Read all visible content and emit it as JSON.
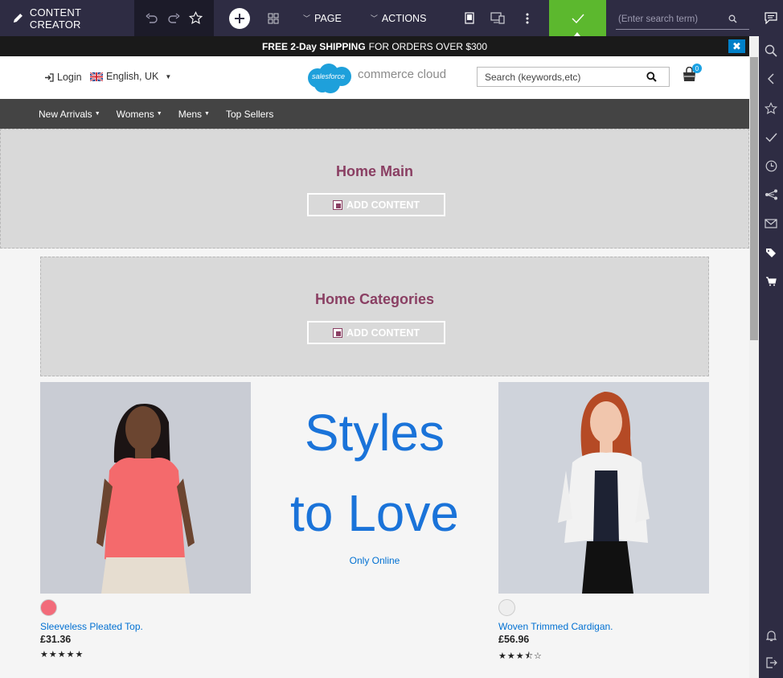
{
  "toolbar": {
    "brand": "CONTENT CREATOR",
    "page_menu": "PAGE",
    "actions_menu": "ACTIONS",
    "search_placeholder": "(Enter search term)",
    "add_icon": "plus-icon"
  },
  "site": {
    "promo_bold": "FREE 2-Day SHIPPING",
    "promo_rest": "FOR ORDERS OVER $300",
    "close_label": "✖",
    "login": "Login",
    "language": "English, UK",
    "logo_cloud": "salesforce",
    "logo_text": "commerce cloud",
    "search_placeholder": "Search (keywords,etc)",
    "cart_count": "0",
    "nav": [
      {
        "label": "New Arrivals",
        "dropdown": true
      },
      {
        "label": "Womens",
        "dropdown": true
      },
      {
        "label": "Mens",
        "dropdown": true
      },
      {
        "label": "Top Sellers",
        "dropdown": false
      }
    ]
  },
  "regions": {
    "home_main": {
      "title": "Home Main",
      "button": "ADD CONTENT"
    },
    "home_categories": {
      "title": "Home Categories",
      "button": "ADD CONTENT"
    }
  },
  "promo_block": {
    "line1": "Styles",
    "line2": "to Love",
    "link": "Only Online"
  },
  "products": [
    {
      "name": "Sleeveless Pleated Top.",
      "price": "£31.36",
      "rating": 5,
      "swatch_color": "#f26b7a"
    },
    {
      "name": "Woven Trimmed Cardigan.",
      "price": "£56.96",
      "rating": 3.5,
      "swatch_color": "#eeeeee"
    }
  ],
  "colors": {
    "toolbar_bg": "#2e2c43",
    "publish_green": "#5cb82e",
    "region_title": "#8a3f63",
    "link_blue": "#0070d2"
  }
}
